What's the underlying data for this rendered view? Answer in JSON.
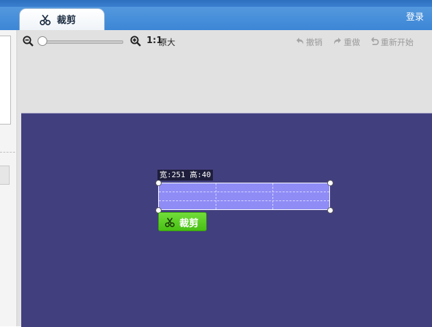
{
  "header": {
    "tab_label": "裁剪",
    "login_label": "登录"
  },
  "toolbar": {
    "zoom_ratio": "1:1",
    "zoom_ratio_text": "原大",
    "undo_label": "撤销",
    "redo_label": "重做",
    "restart_label": "重新开始",
    "zoom_level": 0
  },
  "crop": {
    "size_label": "宽:251 高:40",
    "button_label": "裁剪"
  },
  "colors": {
    "canvas_bg": "#423f7f",
    "selection_fill": "#8f8cf6",
    "crop_button": "#56c61f",
    "header_blue": "#3c86d6"
  },
  "icons": {
    "tab": "scissors-icon",
    "zoom_out": "zoom-out-icon",
    "zoom_in": "zoom-in-icon",
    "undo": "undo-icon",
    "redo": "redo-icon",
    "restart": "restart-icon",
    "crop_button": "scissors-icon"
  }
}
